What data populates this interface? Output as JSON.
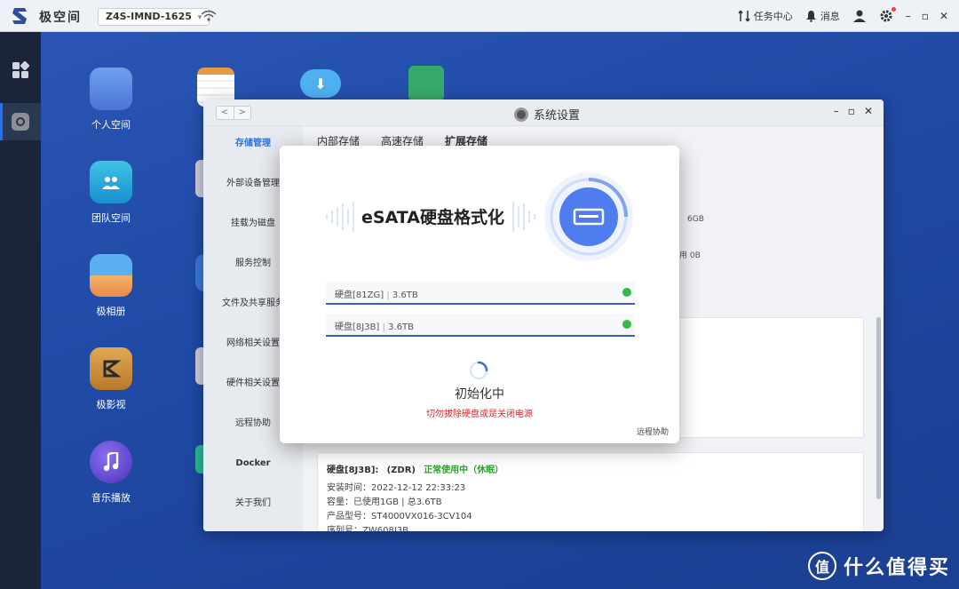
{
  "topbar": {
    "brand": "极空间",
    "device": "Z4S-IMND-1625",
    "device_caret": "▾",
    "task_center": "任务中心",
    "messages": "消息",
    "win_min": "–",
    "win_max": "▫",
    "win_close": "✕"
  },
  "desktop": {
    "apps": [
      {
        "label": "个人空间"
      },
      {
        "label": "团队空间"
      },
      {
        "label": "极相册"
      },
      {
        "label": "极影视"
      },
      {
        "label": "音乐播放"
      }
    ]
  },
  "settings": {
    "title": "系统设置",
    "nav_back": "<",
    "nav_forward": ">",
    "sidebar": [
      {
        "label": "存储管理"
      },
      {
        "label": "外部设备管理"
      },
      {
        "label": "挂载为磁盘"
      },
      {
        "label": "服务控制"
      },
      {
        "label": "文件及共享服务"
      },
      {
        "label": "网络相关设置"
      },
      {
        "label": "硬件相关设置"
      },
      {
        "label": "远程协助"
      },
      {
        "label": "Docker"
      },
      {
        "label": "关于我们"
      }
    ],
    "tabs": [
      {
        "label": "内部存储"
      },
      {
        "label": "高速存储"
      },
      {
        "label": "扩展存储"
      }
    ],
    "bg_value_1": "6GB",
    "bg_value_2": "用 0B",
    "disk": {
      "title": "硬盘[8J3B]:",
      "type": "(ZDR)",
      "status": "正常使用中（休眠）",
      "install_time": "安装时间：2022-12-12 22:33:23",
      "capacity": "容量：已使用1GB | 总3.6TB",
      "model": "产品型号：ST4000VX016-3CV104",
      "serial": "序列号：ZW608J3B"
    }
  },
  "modal": {
    "title": "eSATA硬盘格式化",
    "disks": [
      {
        "name": "硬盘[81ZG]",
        "size": "3.6TB"
      },
      {
        "name": "硬盘[8J3B]",
        "size": "3.6TB"
      }
    ],
    "separator": "|",
    "status": "初始化中",
    "warning": "切勿拔除硬盘或是关闭电源",
    "remote_help": "远程协助"
  },
  "watermark": {
    "logo_char": "值",
    "text": "什么值得买"
  },
  "colors": {
    "accent": "#2f6fe0",
    "desktop_bg": "#1f4aa6",
    "warning": "#e0252b",
    "ok": "#36b84a"
  }
}
